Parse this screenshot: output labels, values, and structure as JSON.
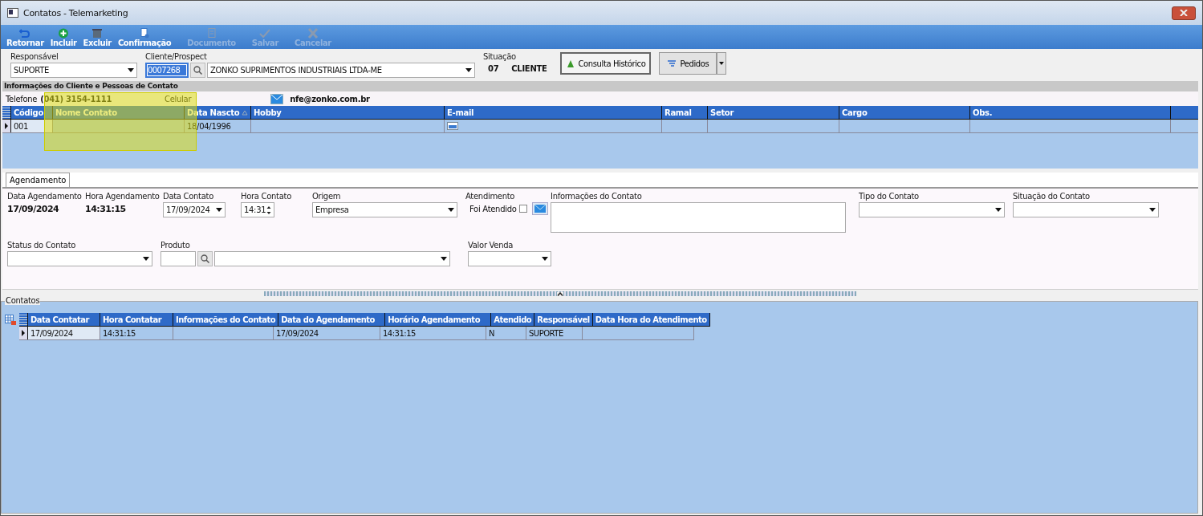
{
  "window": {
    "title": "Contatos - Telemarketing"
  },
  "toolbar": [
    {
      "label": "Retornar",
      "disabled": false
    },
    {
      "label": "Incluir",
      "disabled": false
    },
    {
      "label": "Excluir",
      "disabled": false
    },
    {
      "label": "Confirmação",
      "disabled": false
    },
    {
      "label": "Documento",
      "disabled": true
    },
    {
      "label": "Salvar",
      "disabled": true
    },
    {
      "label": "Cancelar",
      "disabled": true
    }
  ],
  "header": {
    "responsavel": {
      "label": "Responsável",
      "value": "SUPORTE"
    },
    "cliente": {
      "label": "Cliente/Prospect",
      "code": "0007268",
      "name": "ZONKO SUPRIMENTOS INDUSTRIAIS LTDA-ME"
    },
    "situacao": {
      "label": "Situação",
      "code": "07",
      "value": "CLIENTE"
    },
    "buttons": [
      "Consulta Histórico",
      "Pedidos"
    ]
  },
  "client_info": {
    "title": "Informações do Cliente e Pessoas de Contato",
    "phone_label": "Telefone",
    "phone": "(041) 3154-1111",
    "mobile_label": "Celular",
    "email": "nfe@zonko.com.br"
  },
  "contacts_table": {
    "columns": [
      {
        "label": "Código"
      },
      {
        "label": "Nome Contato"
      },
      {
        "label": "Data Nascto"
      },
      {
        "label": "Hobby"
      },
      {
        "label": "E-mail"
      },
      {
        "label": "Ramal"
      },
      {
        "label": "Setor"
      },
      {
        "label": "Cargo"
      },
      {
        "label": "Obs."
      }
    ],
    "rows": [
      [
        "001",
        "",
        "18/04/1996",
        "",
        "",
        "",
        "",
        "",
        ""
      ]
    ]
  },
  "tabs": [
    {
      "label": "Agendamento",
      "selected": true
    }
  ],
  "schedule": {
    "data_agendamento": {
      "label": "Data Agendamento",
      "value": "17/09/2024"
    },
    "hora_agendamento": {
      "label": "Hora Agendamento",
      "value": "14:31:15"
    },
    "data_contato": {
      "label": "Data Contato",
      "value": "17/09/2024"
    },
    "hora_contato": {
      "label": "Hora Contato",
      "value": "14:31"
    },
    "origem": {
      "label": "Origem",
      "value": "Empresa"
    },
    "atendimento": {
      "label": "Atendimento",
      "check_label": "Foi Atendido",
      "checked": false
    },
    "informacoes": {
      "label": "Informações do Contato"
    },
    "tipo": {
      "label": "Tipo do Contato"
    },
    "situacao": {
      "label": "Situação do Contato"
    },
    "status": {
      "label": "Status do Contato"
    },
    "produto": {
      "label": "Produto"
    },
    "valor_venda": {
      "label": "Valor Venda"
    }
  },
  "history": {
    "title": "Contatos",
    "columns": [
      {
        "label": "Data Contatar"
      },
      {
        "label": "Hora Contatar"
      },
      {
        "label": "Informações do Contato"
      },
      {
        "label": "Data do Agendamento"
      },
      {
        "label": "Horário Agendamento"
      },
      {
        "label": "Atendido"
      },
      {
        "label": "Responsável"
      },
      {
        "label": "Data Hora do Atendimento"
      }
    ],
    "rows": [
      [
        "17/09/2024",
        "14:31:15",
        "",
        "17/09/2024",
        "14:31:15",
        "N",
        "SUPORTE",
        ""
      ]
    ]
  }
}
